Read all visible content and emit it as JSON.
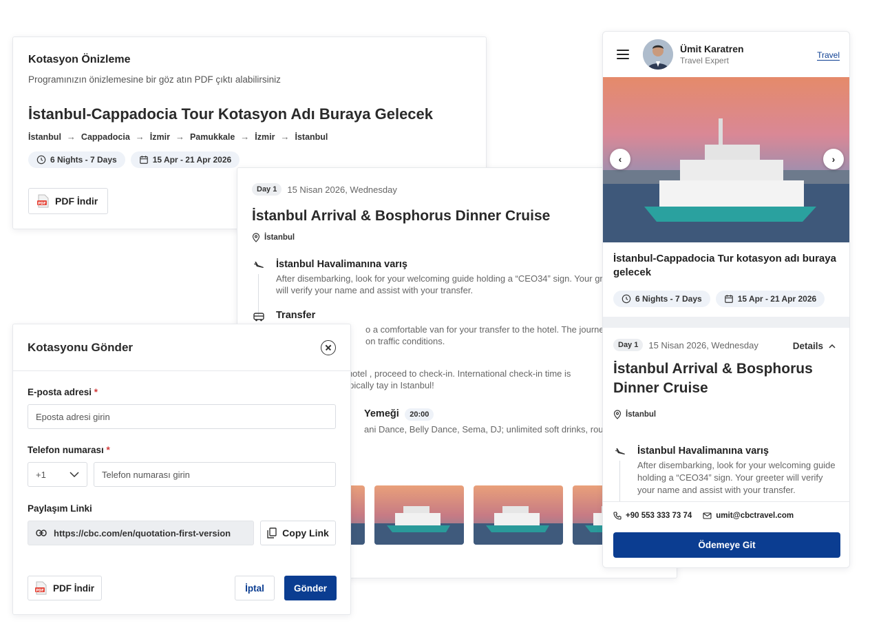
{
  "preview": {
    "heading": "Kotasyon Önizleme",
    "subtitle": "Programınızın önizlemesine bir göz atın PDF çıktı alabilirsiniz",
    "title": "İstanbul-Cappadocia Tour Kotasyon Adı Buraya Gelecek",
    "route": [
      "İstanbul",
      "Cappadocia",
      "İzmir",
      "Pamukkale",
      "İzmir",
      "İstanbul"
    ],
    "duration": "6 Nights - 7 Days",
    "dates": "15 Apr - 21 Apr 2026",
    "pdf_label": "PDF İndir"
  },
  "day": {
    "badge": "Day 1",
    "date": "15 Nisan 2026, Wednesday",
    "title": "İstanbul Arrival & Bosphorus Dinner Cruise",
    "location": "İstanbul",
    "items": [
      {
        "title": "İstanbul Havalimanına varış",
        "text": "After disembarking, look for your welcoming guide holding a “CEO34” sign. Your greeter will verify your name and assist with your transfer."
      },
      {
        "title": "Transfer",
        "text": "o a comfortable van for your transfer to the hotel. The journey takes depending on traffic conditions."
      },
      {
        "title": "",
        "text": "r hotel , proceed to check-in. International check-in time is typically tay in Istanbul!"
      },
      {
        "title": "Yemeği",
        "time": "20:00",
        "text": "ani Dance, Belly Dance, Sema, DJ; unlimited soft drinks, round-trip"
      }
    ]
  },
  "send": {
    "title": "Kotasyonu Gönder",
    "email_label": "E-posta adresi",
    "email_placeholder": "Eposta adresi girin",
    "phone_label": "Telefon numarası",
    "phone_code": "+1",
    "phone_placeholder": "Telefon numarası girin",
    "share_label": "Paylaşım Linki",
    "share_link": "https://cbc.com/en/quotation-first-version",
    "copy_label": "Copy Link",
    "pdf_label": "PDF İndir",
    "cancel_label": "İptal",
    "send_label": "Gönder",
    "required_mark": "*"
  },
  "mobile": {
    "agent_name": "Ümit Karatren",
    "agent_role": "Travel Expert",
    "brand": "Travel",
    "title": "İstanbul-Cappadocia Tur kotasyon adı buraya gelecek",
    "duration": "6 Nights - 7 Days",
    "dates": "15 Apr - 21 Apr 2026",
    "day_badge": "Day 1",
    "day_date": "15 Nisan 2026, Wednesday",
    "details_label": "Details",
    "day_title": "İstanbul Arrival & Bosphorus Dinner Cruise",
    "location": "İstanbul",
    "item_title": "İstanbul Havalimanına varış",
    "item_text": "After disembarking, look for your welcoming guide holding a “CEO34” sign. Your greeter will verify your name and assist with your transfer.",
    "phone": "+90 553 333 73 74",
    "email": "umit@cbctravel.com",
    "pay_label": "Ödemeye Git"
  },
  "colors": {
    "primary": "#0b3d91",
    "chip_bg": "#eef2f8",
    "required": "#d23a3a"
  }
}
